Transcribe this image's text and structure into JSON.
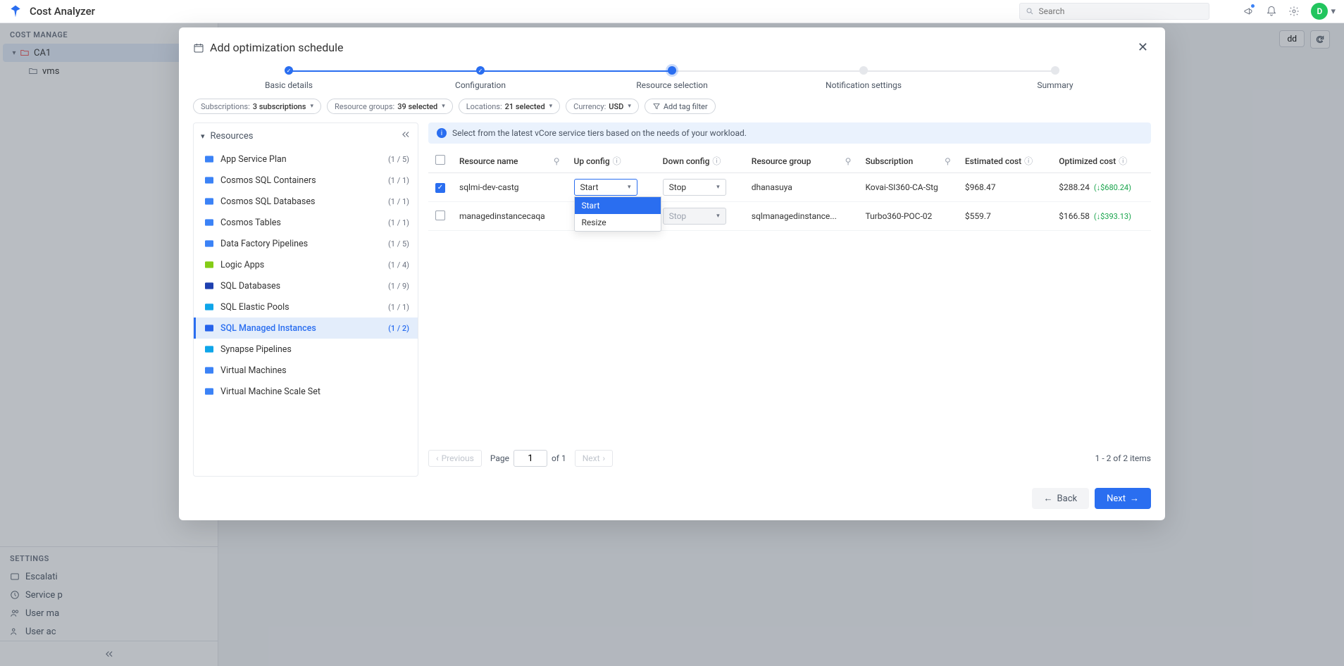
{
  "app": {
    "title": "Cost Analyzer"
  },
  "search": {
    "placeholder": "Search"
  },
  "avatar": {
    "initial": "D"
  },
  "sidebar": {
    "section1": "COST MANAGE",
    "tree": {
      "root": "CA1",
      "child": "vms"
    },
    "section2": "SETTINGS",
    "nav": [
      "Escalati",
      "Service p",
      "User ma",
      "User ac"
    ]
  },
  "main_toolbar": {
    "add": "dd"
  },
  "modal": {
    "title": "Add optimization schedule",
    "steps": [
      "Basic details",
      "Configuration",
      "Resource selection",
      "Notification settings",
      "Summary"
    ],
    "filters": {
      "subscriptions_lbl": "Subscriptions:",
      "subscriptions_val": "3 subscriptions",
      "rg_lbl": "Resource groups:",
      "rg_val": "39 selected",
      "loc_lbl": "Locations:",
      "loc_val": "21 selected",
      "cur_lbl": "Currency:",
      "cur_val": "USD",
      "tagfilter": "Add tag filter"
    },
    "resources_title": "Resources",
    "resource_types": [
      {
        "name": "App Service Plan",
        "count": "(1 / 5)",
        "color": "#3b82f6"
      },
      {
        "name": "Cosmos SQL Containers",
        "count": "(1 / 1)",
        "color": "#3b82f6"
      },
      {
        "name": "Cosmos SQL Databases",
        "count": "(1 / 1)",
        "color": "#3b82f6"
      },
      {
        "name": "Cosmos Tables",
        "count": "(1 / 1)",
        "color": "#3b82f6"
      },
      {
        "name": "Data Factory Pipelines",
        "count": "(1 / 5)",
        "color": "#3b82f6"
      },
      {
        "name": "Logic Apps",
        "count": "(1 / 4)",
        "color": "#84cc16"
      },
      {
        "name": "SQL Databases",
        "count": "(1 / 9)",
        "color": "#1e40af"
      },
      {
        "name": "SQL Elastic Pools",
        "count": "(1 / 1)",
        "color": "#0ea5e9"
      },
      {
        "name": "SQL Managed Instances",
        "count": "(1 / 2)",
        "color": "#2563eb",
        "selected": true
      },
      {
        "name": "Synapse Pipelines",
        "count": "",
        "color": "#0ea5e9"
      },
      {
        "name": "Virtual Machines",
        "count": "",
        "color": "#3b82f6"
      },
      {
        "name": "Virtual Machine Scale Set",
        "count": "",
        "color": "#3b82f6"
      }
    ],
    "info_text": "Select from the latest vCore service tiers based on the needs of your workload.",
    "columns": {
      "resource_name": "Resource name",
      "up": "Up config",
      "down": "Down config",
      "rg": "Resource group",
      "sub": "Subscription",
      "est": "Estimated cost",
      "opt": "Optimized cost"
    },
    "rows": [
      {
        "checked": true,
        "name": "sqlmi-dev-castg",
        "up": "Start",
        "down": "Stop",
        "rg": "dhanasuya",
        "sub": "Kovai-SI360-CA-Stg",
        "est": "$968.47",
        "opt": "$288.24",
        "sav": "↓$680.24"
      },
      {
        "checked": false,
        "name": "managedinstancecaqa",
        "up": "",
        "down": "Stop",
        "down_disabled": true,
        "rg": "sqlmanagedinstance...",
        "sub": "Turbo360-POC-02",
        "est": "$559.7",
        "opt": "$166.58",
        "sav": "↓$393.13"
      }
    ],
    "dropdown_options": [
      "Start",
      "Resize"
    ],
    "pager": {
      "prev": "Previous",
      "page_lbl": "Page",
      "page": "1",
      "of": "of 1",
      "next": "Next",
      "info": "1 - 2 of 2 items"
    },
    "buttons": {
      "back": "Back",
      "next": "Next"
    }
  }
}
